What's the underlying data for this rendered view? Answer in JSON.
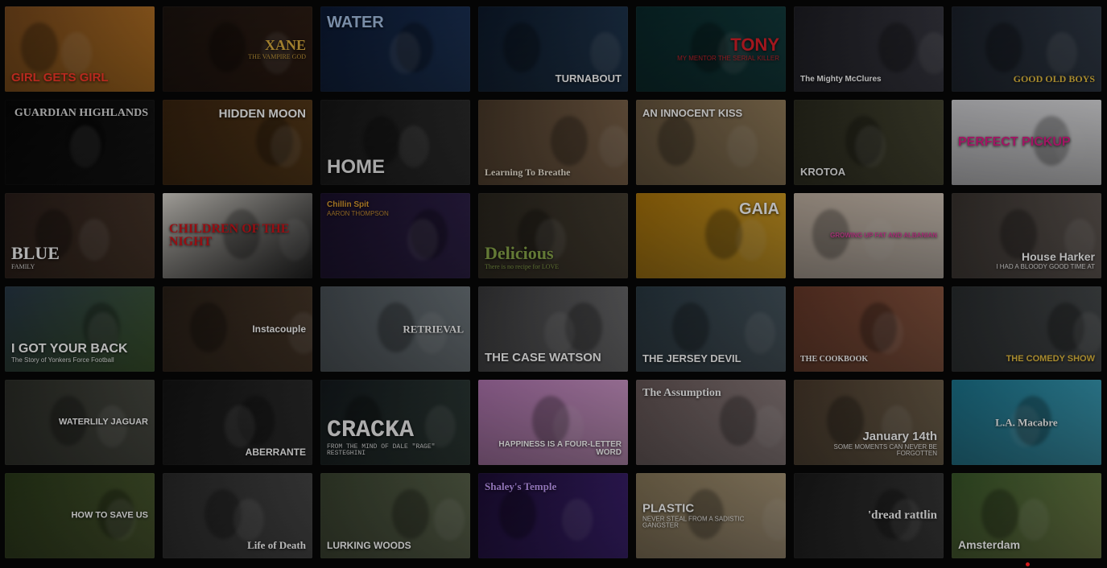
{
  "tiles": [
    {
      "title": "GIRL GETS GIRL",
      "sub": "",
      "bg": [
        "#7a4a1e",
        "#d98a2a"
      ],
      "color": "#ff3a2a",
      "pos": "bottom",
      "size": 15,
      "font": "sans"
    },
    {
      "title": "XANE",
      "sub": "THE VAMPIRE GOD",
      "bg": [
        "#1c1410",
        "#3a2418"
      ],
      "color": "#e0b040",
      "pos": "center-right",
      "size": 18,
      "font": "serif"
    },
    {
      "title": "WATER",
      "sub": "",
      "bg": [
        "#0c1a36",
        "#24406a"
      ],
      "color": "#a8c4e8",
      "pos": "top",
      "size": 20,
      "font": "sans"
    },
    {
      "title": "TURNABOUT",
      "sub": "",
      "bg": [
        "#0d1a2c",
        "#2a4664"
      ],
      "color": "#ffffff",
      "pos": "bottom-right",
      "size": 13,
      "font": "sans"
    },
    {
      "title": "TONY",
      "sub": "MY MENTOR THE SERIAL KILLER",
      "bg": [
        "#0a2a2c",
        "#18484a"
      ],
      "color": "#e0202a",
      "pos": "right",
      "size": 22,
      "font": "sans"
    },
    {
      "title": "The Mighty McClures",
      "sub": "",
      "bg": [
        "#1e1e24",
        "#4a4a56"
      ],
      "color": "#ffffff",
      "pos": "bottom",
      "size": 10,
      "font": "sans"
    },
    {
      "title": "GOOD OLD BOYS",
      "sub": "",
      "bg": [
        "#1c222c",
        "#3e4a5a"
      ],
      "color": "#e8c040",
      "pos": "bottom-right",
      "size": 12,
      "font": "serif"
    },
    {
      "title": "GUARDIAN HIGHLANDS",
      "sub": "",
      "bg": [
        "#060606",
        "#1a1a1a"
      ],
      "color": "#e0e0e0",
      "pos": "top-right",
      "size": 14,
      "font": "serif"
    },
    {
      "title": "HIDDEN MOON",
      "sub": "",
      "bg": [
        "#3a2410",
        "#6a4820"
      ],
      "color": "#ffffff",
      "pos": "top-right",
      "size": 15,
      "font": "sans"
    },
    {
      "title": "HOME",
      "sub": "",
      "bg": [
        "#161616",
        "#3a3a3a"
      ],
      "color": "#e8e8e8",
      "pos": "bottom",
      "size": 24,
      "font": "sans"
    },
    {
      "title": "Learning To Breathe",
      "sub": "",
      "bg": [
        "#4a3a2a",
        "#a08060"
      ],
      "color": "#f0e8d8",
      "pos": "bottom",
      "size": 12,
      "font": "serif"
    },
    {
      "title": "AN INNOCENT KISS",
      "sub": "",
      "bg": [
        "#6a5840",
        "#b49a70"
      ],
      "color": "#ffffff",
      "pos": "top",
      "size": 13,
      "font": "sans"
    },
    {
      "title": "KROTOA",
      "sub": "",
      "bg": [
        "#2a2a1e",
        "#5a5a40"
      ],
      "color": "#f0f0f0",
      "pos": "bottom",
      "size": 13,
      "font": "sans"
    },
    {
      "title": "PERFECT PICKUP",
      "sub": "",
      "bg": [
        "#d8d8dc",
        "#f4f4f6"
      ],
      "color": "#e01e8a",
      "pos": "left",
      "size": 16,
      "font": "sans"
    },
    {
      "title": "BLUE",
      "sub": "FAMILY",
      "bg": [
        "#2a1e1a",
        "#5a4434"
      ],
      "color": "#f4f4f4",
      "pos": "bottom",
      "size": 22,
      "font": "serif"
    },
    {
      "title": "CHILDREN OF THE NIGHT",
      "sub": "",
      "bg": [
        "#e8e4dc",
        "#2a2a2a"
      ],
      "color": "#d0141a",
      "pos": "left",
      "size": 16,
      "font": "serif"
    },
    {
      "title": "Chillin Spit",
      "sub": "AARON THOMPSON",
      "bg": [
        "#1a102c",
        "#3a2a5a"
      ],
      "color": "#e0a030",
      "pos": "top",
      "size": 10,
      "font": "sans"
    },
    {
      "title": "Delicious",
      "sub": "There is no recipe for LOVE",
      "bg": [
        "#2a261e",
        "#5a5040"
      ],
      "color": "#8aa84a",
      "pos": "bottom",
      "size": 22,
      "font": "serif"
    },
    {
      "title": "GAIA",
      "sub": "",
      "bg": [
        "#b0780a",
        "#f0b830"
      ],
      "color": "#ffffff",
      "pos": "top-right",
      "size": 20,
      "font": "sans"
    },
    {
      "title": "GROWING UP FAT AND ALBANIAN",
      "sub": "",
      "bg": [
        "#c8b8a8",
        "#e8dcd0"
      ],
      "color": "#e040a0",
      "pos": "right",
      "size": 8,
      "font": "sans"
    },
    {
      "title": "House Harker",
      "sub": "I HAD A BLOODY GOOD TIME AT",
      "bg": [
        "#3a3430",
        "#7a706a"
      ],
      "color": "#ffffff",
      "pos": "bottom-right",
      "size": 14,
      "font": "sans"
    },
    {
      "title": "I GOT YOUR BACK",
      "sub": "The Story of Yonkers Force Football",
      "bg": [
        "#2a3a4a",
        "#4a6a3a"
      ],
      "color": "#ffffff",
      "pos": "bottom",
      "size": 16,
      "font": "sans"
    },
    {
      "title": "Instacouple",
      "sub": "",
      "bg": [
        "#2a2018",
        "#5a4634"
      ],
      "color": "#ffffff",
      "pos": "center-right",
      "size": 12,
      "font": "sans"
    },
    {
      "title": "RETRIEVAL",
      "sub": "",
      "bg": [
        "#4a5258",
        "#8a949a"
      ],
      "color": "#ffffff",
      "pos": "center-right",
      "size": 13,
      "font": "serif"
    },
    {
      "title": "THE CASE WATSON",
      "sub": "",
      "bg": [
        "#3a3a3c",
        "#8a8a8c"
      ],
      "color": "#ffffff",
      "pos": "bottom",
      "size": 15,
      "font": "sans"
    },
    {
      "title": "THE JERSEY DEVIL",
      "sub": "",
      "bg": [
        "#2a3a44",
        "#5a6a74"
      ],
      "color": "#ffffff",
      "pos": "bottom",
      "size": 13,
      "font": "sans"
    },
    {
      "title": "THE COOKBOOK",
      "sub": "",
      "bg": [
        "#6a3a2a",
        "#a46a50"
      ],
      "color": "#ffffff",
      "pos": "bottom",
      "size": 10,
      "font": "serif"
    },
    {
      "title": "THE COMEDY SHOW",
      "sub": "",
      "bg": [
        "#2a2e30",
        "#5a5e60"
      ],
      "color": "#e8c040",
      "pos": "bottom-right",
      "size": 11,
      "font": "sans"
    },
    {
      "title": "WATERLILY JAGUAR",
      "sub": "",
      "bg": [
        "#2c2e28",
        "#5c5e54"
      ],
      "color": "#ffffff",
      "pos": "center-right",
      "size": 11,
      "font": "sans"
    },
    {
      "title": "ABERRANTE",
      "sub": "",
      "bg": [
        "#141414",
        "#3a3a3a"
      ],
      "color": "#ffffff",
      "pos": "bottom-right",
      "size": 12,
      "font": "sans"
    },
    {
      "title": "CRACKA",
      "sub": "FROM THE MIND OF DALE \"RAGE\" RESTEGHINI",
      "bg": [
        "#141a1e",
        "#3a4a44"
      ],
      "color": "#f0f0f0",
      "pos": "bottom",
      "size": 30,
      "font": "mono"
    },
    {
      "title": "HAPPINESS IS A FOUR-LETTER WORD",
      "sub": "",
      "bg": [
        "#b87ab8",
        "#e8b0e0"
      ],
      "color": "#ffffff",
      "pos": "bottom-right",
      "size": 10,
      "font": "sans"
    },
    {
      "title": "The Assumption",
      "sub": "",
      "bg": [
        "#6a5a5a",
        "#a89898"
      ],
      "color": "#ffffff",
      "pos": "top",
      "size": 14,
      "font": "serif"
    },
    {
      "title": "January 14th",
      "sub": "SOME MOMENTS CAN NEVER BE FORGOTTEN",
      "bg": [
        "#4a3a2c",
        "#8a7a60"
      ],
      "color": "#ffffff",
      "pos": "bottom-right",
      "size": 15,
      "font": "sans"
    },
    {
      "title": "L.A. Macabre",
      "sub": "",
      "bg": [
        "#1c7a94",
        "#4ab8d4"
      ],
      "color": "#ffffff",
      "pos": "center",
      "size": 13,
      "font": "serif"
    },
    {
      "title": "HOW TO SAVE US",
      "sub": "",
      "bg": [
        "#2a3a1a",
        "#5a6a3a"
      ],
      "color": "#ffffff",
      "pos": "center-right",
      "size": 11,
      "font": "sans"
    },
    {
      "title": "Life of Death",
      "sub": "",
      "bg": [
        "#2a2a2a",
        "#5a5a5a"
      ],
      "color": "#ffffff",
      "pos": "bottom-right",
      "size": 13,
      "font": "serif"
    },
    {
      "title": "LURKING WOODS",
      "sub": "",
      "bg": [
        "#3a4430",
        "#707a5e"
      ],
      "color": "#ffffff",
      "pos": "bottom",
      "size": 12,
      "font": "sans"
    },
    {
      "title": "Shaley's Temple",
      "sub": "",
      "bg": [
        "#1e0e38",
        "#4a2a8a"
      ],
      "color": "#c8a0ff",
      "pos": "top",
      "size": 13,
      "font": "serif"
    },
    {
      "title": "PLASTIC",
      "sub": "NEVER STEAL FROM A SADISTIC GANGSTER",
      "bg": [
        "#8a7a5a",
        "#c4b090"
      ],
      "color": "#ffffff",
      "pos": "center-left",
      "size": 15,
      "font": "sans"
    },
    {
      "title": "'dread rattlin",
      "sub": "",
      "bg": [
        "#1a1a1a",
        "#4a4a4a"
      ],
      "color": "#ffffff",
      "pos": "center-right",
      "size": 15,
      "font": "serif"
    },
    {
      "title": "Amsterdam",
      "sub": "",
      "bg": [
        "#3a5a2a",
        "#8a9a5a"
      ],
      "color": "#ffffff",
      "pos": "bottom",
      "size": 14,
      "font": "sans"
    }
  ]
}
